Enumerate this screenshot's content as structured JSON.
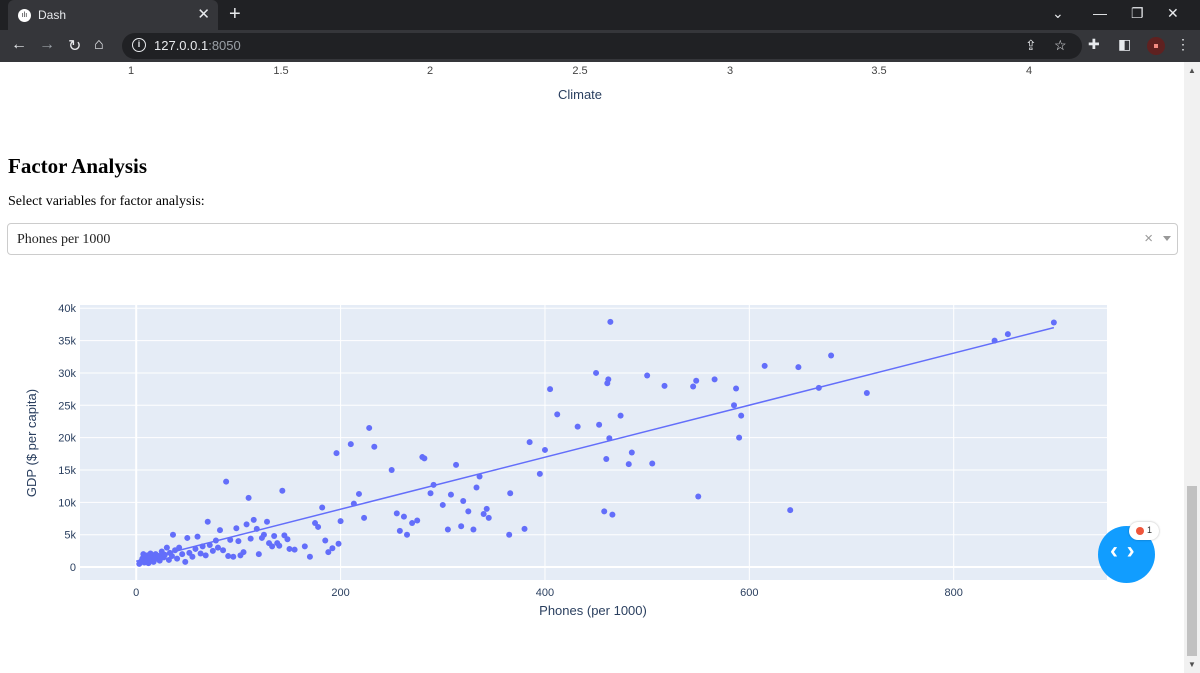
{
  "browser": {
    "tab_title": "Dash",
    "url_host": "127.0.0.1",
    "url_port": ":8050",
    "icons": [
      "back-icon",
      "forward-icon",
      "reload-icon",
      "home-icon",
      "share-icon",
      "star-icon",
      "extensions-icon",
      "sidebar-icon"
    ]
  },
  "previous_chart": {
    "x_ticks": [
      "1",
      "1.5",
      "2",
      "2.5",
      "3",
      "3.5",
      "4"
    ],
    "x_label": "Climate"
  },
  "section": {
    "title": "Factor Analysis",
    "select_label": "Select variables for factor analysis:",
    "dropdown_value": "Phones per 1000",
    "clear_glyph": "×"
  },
  "chart_data": {
    "type": "scatter",
    "xlabel": "Phones (per 1000)",
    "ylabel": "GDP ($ per capita)",
    "x_ticks": [
      "0",
      "200",
      "400",
      "600",
      "800"
    ],
    "y_ticks": [
      "0",
      "5k",
      "10k",
      "15k",
      "20k",
      "25k",
      "30k",
      "35k",
      "40k"
    ],
    "xlim": [
      -55,
      950
    ],
    "ylim": [
      -2000,
      40500
    ],
    "marker_color": "#636efa",
    "background": "#e5ecf6",
    "trendline": {
      "x": [
        0,
        898
      ],
      "y": [
        900,
        37000
      ]
    },
    "points": [
      [
        3,
        500
      ],
      [
        5,
        900
      ],
      [
        6,
        1300
      ],
      [
        7,
        2000
      ],
      [
        8,
        700
      ],
      [
        9,
        1600
      ],
      [
        10,
        1000
      ],
      [
        11,
        1800
      ],
      [
        12,
        600
      ],
      [
        13,
        1400
      ],
      [
        14,
        2100
      ],
      [
        15,
        1100
      ],
      [
        16,
        1800
      ],
      [
        17,
        800
      ],
      [
        18,
        1500
      ],
      [
        19,
        2000
      ],
      [
        20,
        1300
      ],
      [
        22,
        1700
      ],
      [
        23,
        1000
      ],
      [
        25,
        2400
      ],
      [
        27,
        1500
      ],
      [
        28,
        1900
      ],
      [
        30,
        3000
      ],
      [
        32,
        1100
      ],
      [
        33,
        2200
      ],
      [
        35,
        1700
      ],
      [
        36,
        5000
      ],
      [
        38,
        2600
      ],
      [
        40,
        1300
      ],
      [
        42,
        3000
      ],
      [
        45,
        2000
      ],
      [
        48,
        800
      ],
      [
        50,
        4500
      ],
      [
        52,
        2200
      ],
      [
        55,
        1600
      ],
      [
        58,
        2800
      ],
      [
        60,
        4700
      ],
      [
        63,
        2100
      ],
      [
        65,
        3200
      ],
      [
        68,
        1800
      ],
      [
        70,
        7000
      ],
      [
        72,
        3400
      ],
      [
        75,
        2500
      ],
      [
        78,
        4100
      ],
      [
        80,
        3000
      ],
      [
        82,
        5700
      ],
      [
        85,
        2600
      ],
      [
        88,
        13200
      ],
      [
        90,
        1700
      ],
      [
        92,
        4200
      ],
      [
        95,
        1600
      ],
      [
        98,
        6000
      ],
      [
        100,
        4000
      ],
      [
        102,
        1800
      ],
      [
        105,
        2300
      ],
      [
        108,
        6600
      ],
      [
        110,
        10700
      ],
      [
        112,
        4400
      ],
      [
        115,
        7300
      ],
      [
        118,
        5900
      ],
      [
        120,
        2000
      ],
      [
        123,
        4500
      ],
      [
        125,
        5000
      ],
      [
        128,
        7000
      ],
      [
        130,
        3700
      ],
      [
        133,
        3200
      ],
      [
        135,
        4800
      ],
      [
        138,
        3700
      ],
      [
        140,
        3300
      ],
      [
        143,
        11800
      ],
      [
        145,
        4900
      ],
      [
        148,
        4300
      ],
      [
        150,
        2800
      ],
      [
        155,
        2700
      ],
      [
        165,
        3200
      ],
      [
        170,
        1600
      ],
      [
        175,
        6800
      ],
      [
        178,
        6200
      ],
      [
        182,
        9200
      ],
      [
        185,
        4100
      ],
      [
        188,
        2300
      ],
      [
        192,
        2900
      ],
      [
        196,
        17600
      ],
      [
        198,
        3600
      ],
      [
        200,
        7100
      ],
      [
        210,
        19000
      ],
      [
        213,
        9800
      ],
      [
        218,
        11300
      ],
      [
        223,
        7600
      ],
      [
        228,
        21500
      ],
      [
        233,
        18600
      ],
      [
        250,
        15000
      ],
      [
        255,
        8300
      ],
      [
        258,
        5600
      ],
      [
        262,
        7800
      ],
      [
        265,
        5000
      ],
      [
        270,
        6800
      ],
      [
        275,
        7200
      ],
      [
        280,
        17000
      ],
      [
        282,
        16800
      ],
      [
        288,
        11400
      ],
      [
        291,
        12700
      ],
      [
        300,
        9600
      ],
      [
        305,
        5800
      ],
      [
        308,
        11200
      ],
      [
        313,
        15800
      ],
      [
        318,
        6300
      ],
      [
        320,
        10200
      ],
      [
        325,
        8600
      ],
      [
        330,
        5800
      ],
      [
        333,
        12300
      ],
      [
        336,
        14000
      ],
      [
        340,
        8200
      ],
      [
        343,
        9000
      ],
      [
        345,
        7600
      ],
      [
        365,
        5000
      ],
      [
        366,
        11400
      ],
      [
        380,
        5900
      ],
      [
        385,
        19300
      ],
      [
        395,
        14400
      ],
      [
        400,
        18100
      ],
      [
        405,
        27500
      ],
      [
        412,
        23600
      ],
      [
        432,
        21700
      ],
      [
        450,
        30000
      ],
      [
        453,
        22000
      ],
      [
        458,
        8600
      ],
      [
        460,
        16700
      ],
      [
        461,
        28400
      ],
      [
        462,
        29000
      ],
      [
        463,
        19900
      ],
      [
        464,
        37900
      ],
      [
        466,
        8100
      ],
      [
        474,
        23400
      ],
      [
        482,
        15900
      ],
      [
        485,
        17700
      ],
      [
        500,
        29600
      ],
      [
        505,
        16000
      ],
      [
        517,
        28000
      ],
      [
        545,
        27900
      ],
      [
        548,
        28800
      ],
      [
        550,
        10900
      ],
      [
        566,
        29000
      ],
      [
        585,
        25000
      ],
      [
        587,
        27600
      ],
      [
        590,
        20000
      ],
      [
        592,
        23400
      ],
      [
        615,
        31100
      ],
      [
        640,
        8800
      ],
      [
        648,
        30900
      ],
      [
        668,
        27700
      ],
      [
        680,
        32700
      ],
      [
        715,
        26900
      ],
      [
        840,
        35000
      ],
      [
        853,
        36000
      ],
      [
        898,
        37800
      ]
    ]
  },
  "fab": {
    "icon": "code-brackets-icon",
    "badge_count": "1"
  }
}
